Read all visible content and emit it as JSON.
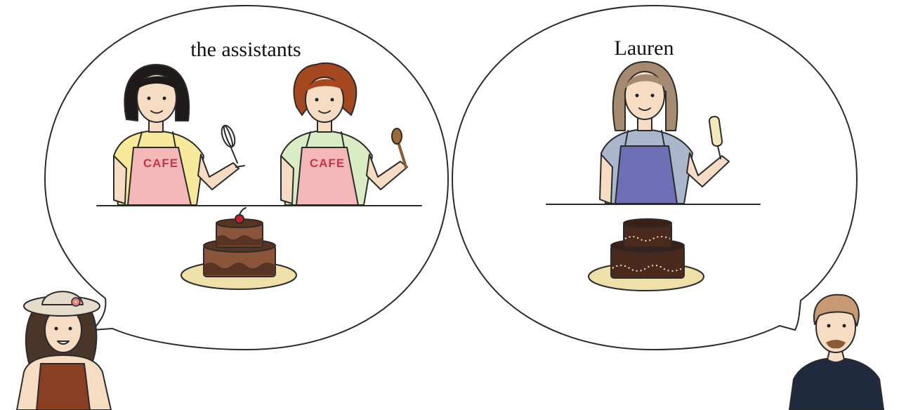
{
  "left_bubble": {
    "label": "the assistants",
    "apron_text_1": "CAFE",
    "apron_text_2": "CAFE"
  },
  "right_bubble": {
    "label": "Lauren"
  },
  "colors": {
    "outline": "#2b2b2b",
    "skin": "#f6dcc3",
    "pink_apron": "#f4b8b8",
    "purple_apron": "#6f6fb8",
    "cake_dark": "#5a3422",
    "cake_mid": "#8a553a",
    "plate": "#eee0a8"
  },
  "icons": {
    "whisk": "whisk-icon",
    "spoon": "wooden-spoon-icon",
    "spatula": "spatula-icon",
    "cherry": "cherry-icon",
    "flower": "hat-flower-icon"
  }
}
